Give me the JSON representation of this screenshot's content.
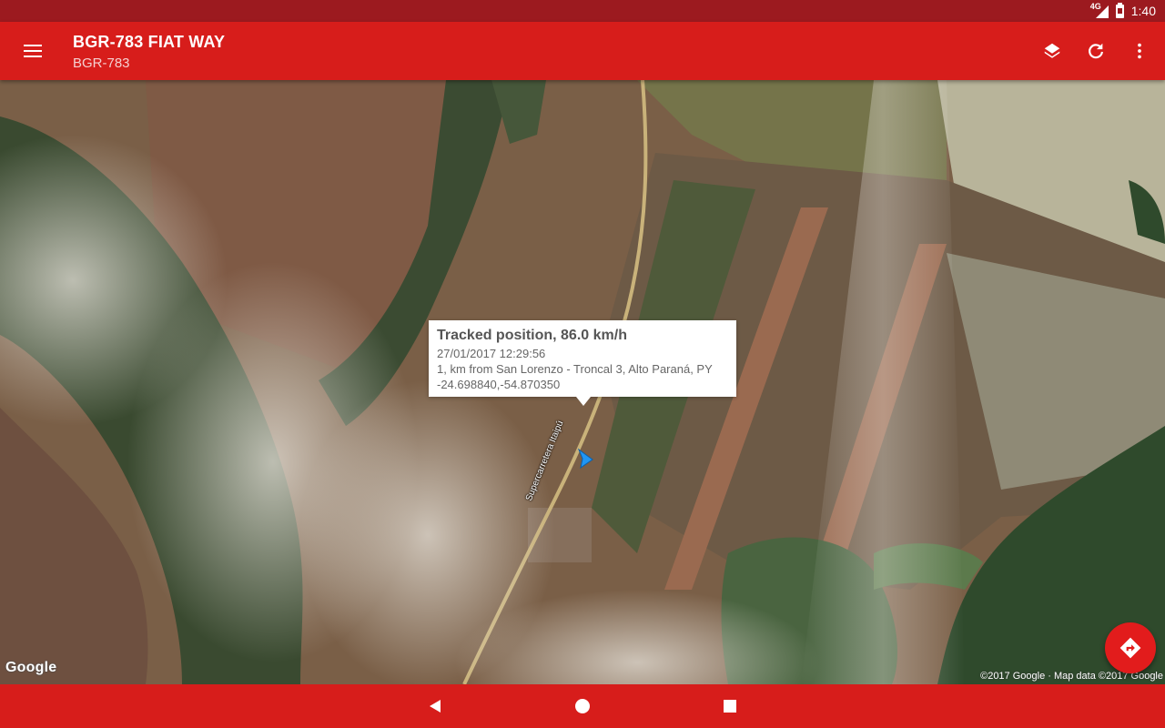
{
  "status_bar": {
    "network": "4G",
    "time": "1:40"
  },
  "app_bar": {
    "title": "BGR-783 FIAT WAY",
    "subtitle": "BGR-783",
    "icons": [
      "menu-icon",
      "layers-icon",
      "refresh-icon",
      "more-vert-icon"
    ]
  },
  "info_window": {
    "title": "Tracked position, 86.0 km/h",
    "datetime": "27/01/2017 12:29:56",
    "address": "1, km from San Lorenzo - Troncal 3, Alto Paraná, PY",
    "coordinates": "-24.698840,-54.870350"
  },
  "map": {
    "road_label": "Supercarretera Itaipú",
    "logo": "Google",
    "attribution": "©2017 Google · Map data ©2017 Google",
    "marker_color": "#2196f3"
  },
  "fab": {
    "icon": "directions-icon",
    "color": "#e21c1c"
  },
  "colors": {
    "primary": "#d71d1b",
    "status_bar": "#9c1a1f"
  }
}
